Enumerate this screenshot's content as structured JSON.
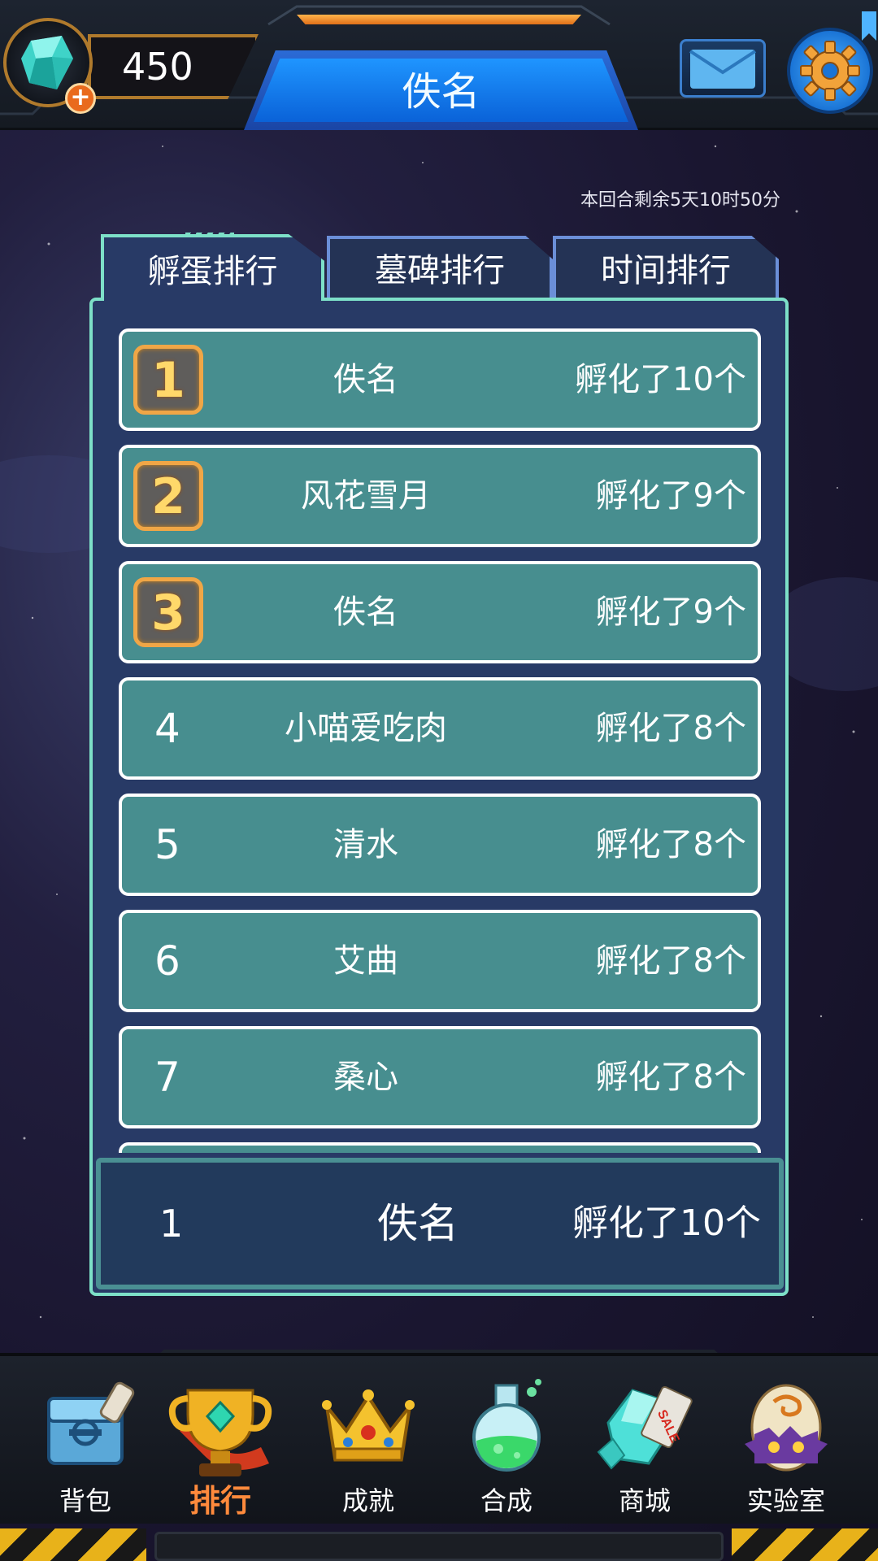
{
  "top": {
    "gem_count": "450",
    "title": "佚名",
    "icons": {
      "gem": "gem-icon",
      "plus": "plus-icon",
      "mail": "mail-icon",
      "settings": "gear-icon"
    }
  },
  "countdown": "本回合剩余5天10时50分",
  "tabs": [
    {
      "label": "孵蛋排行",
      "active": true
    },
    {
      "label": "墓碑排行",
      "active": false
    },
    {
      "label": "时间排行",
      "active": false
    }
  ],
  "leaderboard": [
    {
      "rank": "1",
      "name": "佚名",
      "count": "孵化了10个"
    },
    {
      "rank": "2",
      "name": "风花雪月",
      "count": "孵化了9个"
    },
    {
      "rank": "3",
      "name": "佚名",
      "count": "孵化了9个"
    },
    {
      "rank": "4",
      "name": "小喵爱吃肉",
      "count": "孵化了8个"
    },
    {
      "rank": "5",
      "name": "清水",
      "count": "孵化了8个"
    },
    {
      "rank": "6",
      "name": "艾曲",
      "count": "孵化了8个"
    },
    {
      "rank": "7",
      "name": "桑心",
      "count": "孵化了8个"
    }
  ],
  "my_rank": {
    "rank": "1",
    "name": "佚名",
    "count": "孵化了10个"
  },
  "nav": [
    {
      "label": "背包",
      "icon": "backpack-chest-icon",
      "active": false
    },
    {
      "label": "排行",
      "icon": "trophy-icon",
      "active": true
    },
    {
      "label": "成就",
      "icon": "crown-icon",
      "active": false
    },
    {
      "label": "合成",
      "icon": "potion-flask-icon",
      "active": false
    },
    {
      "label": "商城",
      "icon": "crystal-sale-icon",
      "active": false
    },
    {
      "label": "实验室",
      "icon": "egg-monster-icon",
      "active": false
    }
  ],
  "colors": {
    "row_bg": "#478e8f",
    "panel_bg": "#283a66",
    "panel_border": "#7de0c8",
    "title_blue": "#1f95ff",
    "accent_orange": "#ff8a3c",
    "badge_border": "#f0a646"
  }
}
